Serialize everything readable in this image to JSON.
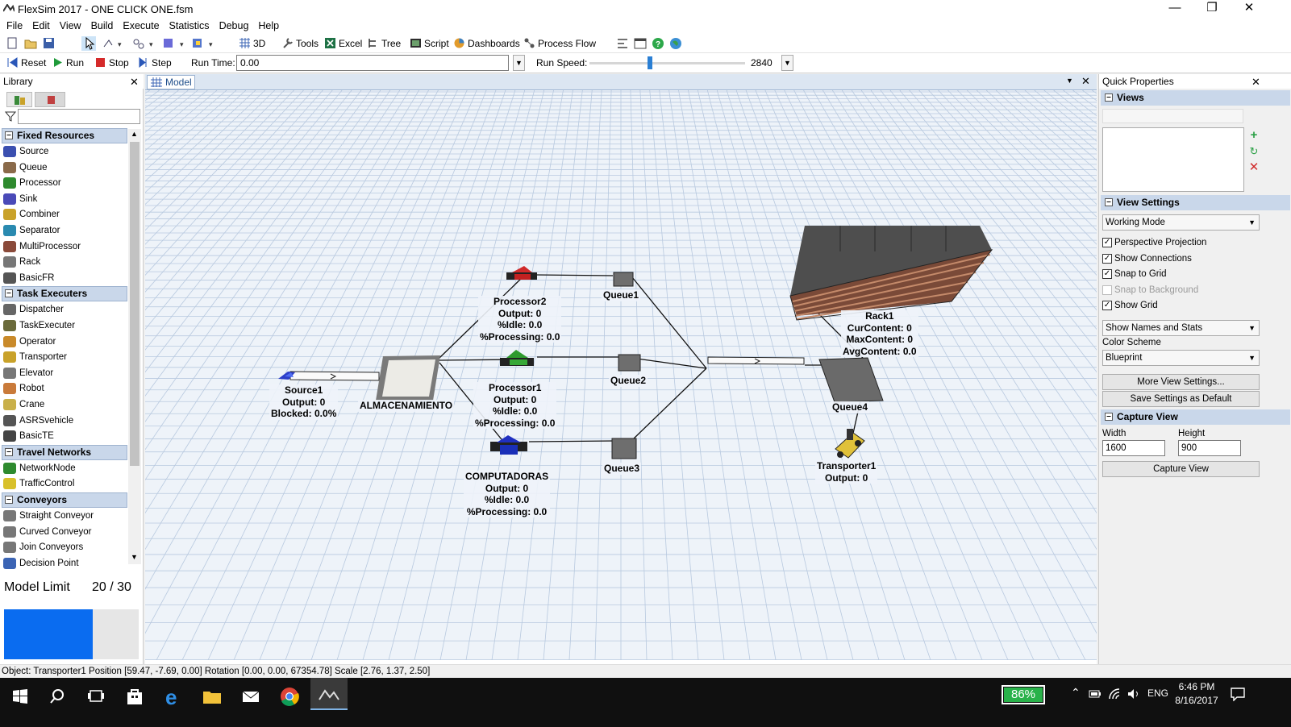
{
  "window": {
    "title": "FlexSim 2017 - ONE CLICK ONE.fsm"
  },
  "menu": [
    "File",
    "Edit",
    "View",
    "Build",
    "Execute",
    "Statistics",
    "Debug",
    "Help"
  ],
  "toolbar": {
    "view3d": "3D",
    "tools": "Tools",
    "excel": "Excel",
    "tree": "Tree",
    "script": "Script",
    "dashboards": "Dashboards",
    "process_flow": "Process Flow"
  },
  "runbar": {
    "reset": "Reset",
    "run": "Run",
    "stop": "Stop",
    "step": "Step",
    "run_time_label": "Run Time:",
    "run_time_value": "0.00",
    "run_speed_label": "Run Speed:",
    "run_speed_value": "2840"
  },
  "library": {
    "title": "Library",
    "categories": [
      {
        "label": "Fixed Resources",
        "items": [
          "Source",
          "Queue",
          "Processor",
          "Sink",
          "Combiner",
          "Separator",
          "MultiProcessor",
          "Rack",
          "BasicFR"
        ]
      },
      {
        "label": "Task Executers",
        "items": [
          "Dispatcher",
          "TaskExecuter",
          "Operator",
          "Transporter",
          "Elevator",
          "Robot",
          "Crane",
          "ASRSvehicle",
          "BasicTE"
        ]
      },
      {
        "label": "Travel Networks",
        "items": [
          "NetworkNode",
          "TrafficControl"
        ]
      },
      {
        "label": "Conveyors",
        "items": [
          "Straight Conveyor",
          "Curved Conveyor",
          "Join Conveyors",
          "Decision Point"
        ]
      }
    ],
    "model_limit_label": "Model Limit",
    "model_limit_value": "20 / 30",
    "model_limit_fraction": 0.667
  },
  "model_tab": {
    "label": "Model"
  },
  "model": {
    "source1": {
      "name": "Source1",
      "lines": [
        "Output: 0",
        "Blocked: 0.0%"
      ]
    },
    "almacenamiento": {
      "name": "ALMACENAMIENTO"
    },
    "processor2": {
      "name": "Processor2",
      "lines": [
        "Output: 0",
        "%Idle:  0.0",
        "%Processing: 0.0"
      ]
    },
    "processor1": {
      "name": "Processor1",
      "lines": [
        "Output: 0",
        "%Idle:  0.0",
        "%Processing: 0.0"
      ]
    },
    "computadoras": {
      "name": "COMPUTADORAS",
      "lines": [
        "Output: 0",
        "%Idle:  0.0",
        "%Processing: 0.0"
      ]
    },
    "queue1": {
      "name": "Queue1"
    },
    "queue2": {
      "name": "Queue2"
    },
    "queue3": {
      "name": "Queue3"
    },
    "queue4": {
      "name": "Queue4"
    },
    "rack1": {
      "name": "Rack1",
      "lines": [
        "CurContent:  0",
        "MaxContent: 0",
        "AvgContent:  0.0"
      ]
    },
    "transporter1": {
      "name": "Transporter1",
      "lines": [
        "Output: 0"
      ]
    }
  },
  "quick_properties": {
    "title": "Quick Properties",
    "views_section": "Views",
    "view_settings_section": "View Settings",
    "mode": "Working Mode",
    "checks": [
      {
        "label": "Perspective Projection",
        "checked": true,
        "disabled": false
      },
      {
        "label": "Show Connections",
        "checked": true,
        "disabled": false
      },
      {
        "label": "Snap to Grid",
        "checked": true,
        "disabled": false
      },
      {
        "label": "Snap to Background",
        "checked": false,
        "disabled": true
      },
      {
        "label": "Show Grid",
        "checked": true,
        "disabled": false
      }
    ],
    "names_stats": "Show Names and Stats",
    "color_scheme_label": "Color Scheme",
    "color_scheme_value": "Blueprint",
    "more_view_settings": "More View Settings...",
    "save_default": "Save Settings as Default",
    "capture_section": "Capture View",
    "width_label": "Width",
    "width_value": "1600",
    "height_label": "Height",
    "height_value": "900",
    "capture_button": "Capture View"
  },
  "status": {
    "text": "Object: Transporter1 Position [59.47, -7.69, 0.00]  Rotation [0.00, 0.00, 67354.78]  Scale [2.76, 1.37, 2.50]"
  },
  "taskbar": {
    "battery": "86%",
    "lang": "ENG",
    "time": "6:46 PM",
    "date": "8/16/2017"
  },
  "colors": {
    "category_bg": "#c9d7ea",
    "model_limit_bar": "#0a6cf0",
    "grid_bg": "#eef3f9",
    "battery": "#29b24a"
  }
}
